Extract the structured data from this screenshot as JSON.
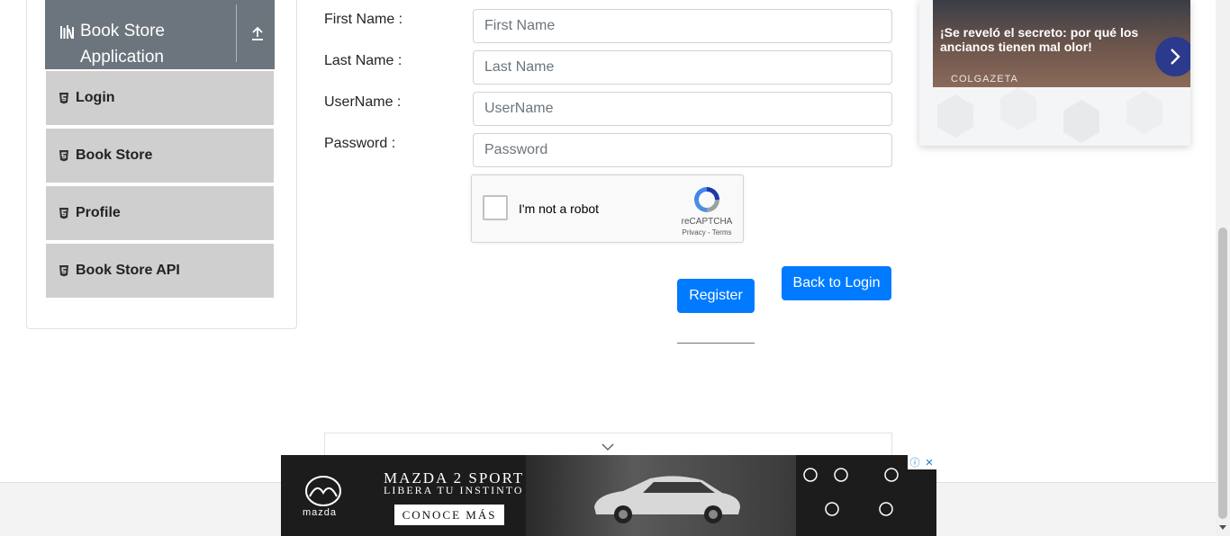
{
  "sidebar": {
    "group_title": "Book Store Application",
    "items": [
      {
        "label": "Login"
      },
      {
        "label": "Book Store"
      },
      {
        "label": "Profile"
      },
      {
        "label": "Book Store API"
      }
    ]
  },
  "form": {
    "first_name": {
      "label": "First Name :",
      "placeholder": "First Name",
      "value": ""
    },
    "last_name": {
      "label": "Last Name :",
      "placeholder": "Last Name",
      "value": ""
    },
    "username": {
      "label": "UserName :",
      "placeholder": "UserName",
      "value": ""
    },
    "password": {
      "label": "Password :",
      "placeholder": "Password",
      "value": ""
    },
    "recaptcha": {
      "label": "I'm not a robot",
      "brand": "reCAPTCHA",
      "links": "Privacy - Terms",
      "checked": false
    },
    "register_label": "Register",
    "back_label": "Back to Login"
  },
  "right_ad": {
    "headline": "¡Se reveló el secreto: por qué los ancianos tienen mal olor!",
    "source": "COLGAZETA"
  },
  "banner_ad": {
    "brand": "mazda",
    "title": "MAZDA 2 SPORT",
    "subtitle": "LIBERA TU INSTINTO",
    "cta": "CONOCE MÁS"
  },
  "colors": {
    "primary": "#007bff",
    "sidebar_header": "#6c757d",
    "menu_item_bg": "#cfcfcf"
  }
}
